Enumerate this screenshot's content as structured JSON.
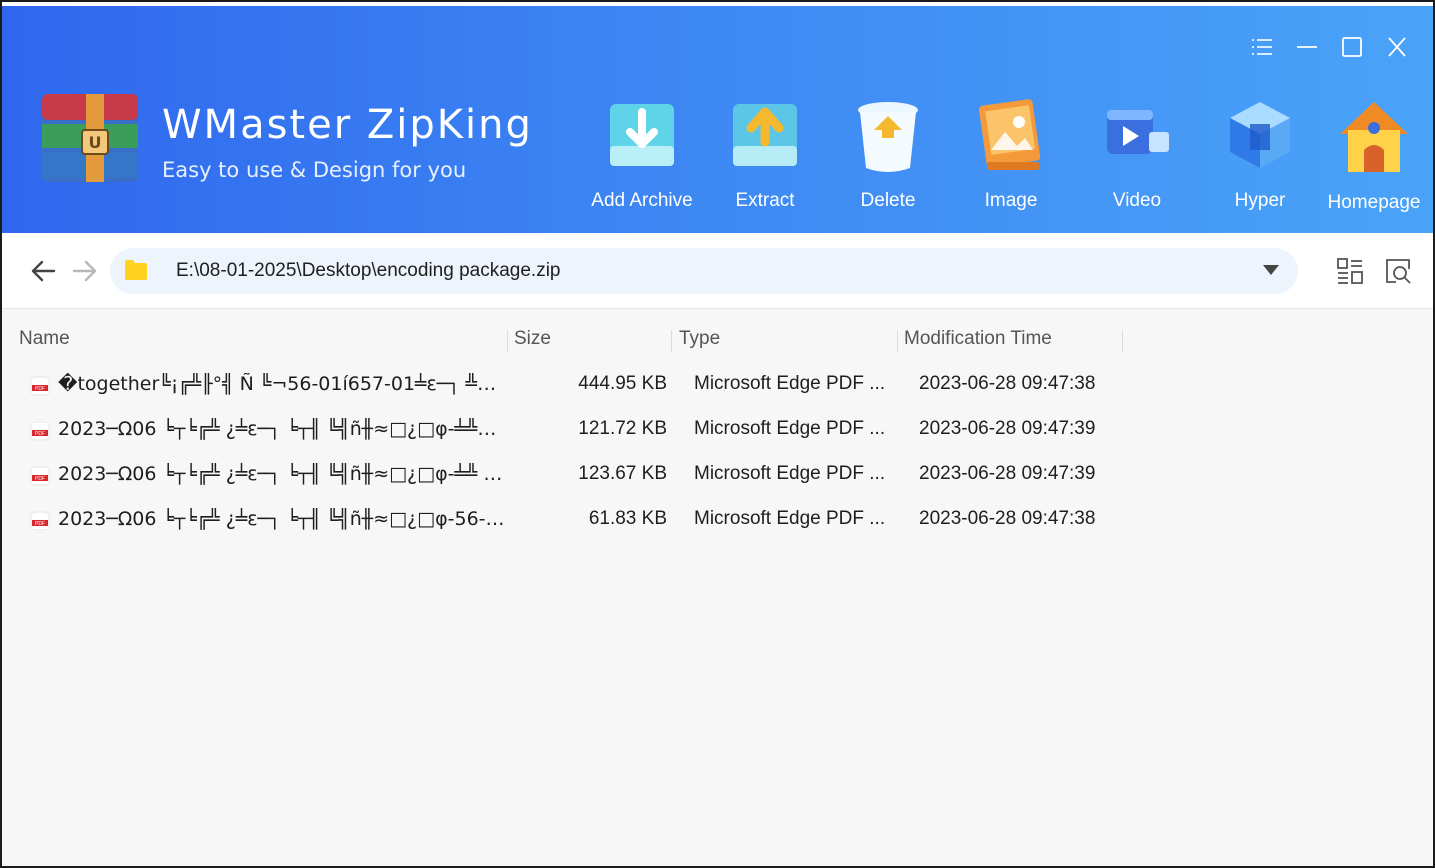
{
  "app": {
    "title": "WMaster ZipKing",
    "subtitle": "Easy to use & Design for you"
  },
  "toolbar": [
    {
      "label": "Add Archive",
      "icon": "add-archive-icon"
    },
    {
      "label": "Extract",
      "icon": "extract-icon"
    },
    {
      "label": "Delete",
      "icon": "delete-icon"
    },
    {
      "label": "Image",
      "icon": "image-icon"
    },
    {
      "label": "Video",
      "icon": "video-icon"
    },
    {
      "label": "Hyper",
      "icon": "hyper-icon"
    },
    {
      "label": "Homepage",
      "icon": "homepage-icon"
    }
  ],
  "window_controls": [
    "menu-icon",
    "minimize-icon",
    "maximize-icon",
    "close-icon"
  ],
  "navigation": {
    "path": "E:\\08-01-2025\\Desktop\\encoding package.zip"
  },
  "columns": {
    "name": "Name",
    "size": "Size",
    "type": "Type",
    "modified": "Modification Time"
  },
  "files": [
    {
      "name": "�together╚¡╔╩╟°╣ Ñ ╚¬56-01í657-01╧ε─┐ ╩╣╪≤╩°╢ ╚╩╟...",
      "size": "444.95 KB",
      "type": "Microsoft Edge PDF ...",
      "modified": "2023-06-28 09:47:38"
    },
    {
      "name": "2023─Ω06 ╘┬╘╔╩ ¿╧ε─┐ ╘┬╢ ╚╣ñ╫≈□¿□φ-╧╩╕ ·┴...",
      "size": "121.72 KB",
      "type": "Microsoft Edge PDF ...",
      "modified": "2023-06-28 09:47:39"
    },
    {
      "name": "2023─Ω06 ╘┬╘╔╩ ¿╧ε─┐ ╘┬╢ ╚╣ñ╫≈□¿□φ-╧╩ ╟□...",
      "size": "123.67 KB",
      "type": "Microsoft Edge PDF ...",
      "modified": "2023-06-28 09:47:39"
    },
    {
      "name": "2023─Ω06 ╘┬╘╔╩ ¿╧ε─┐ ╘┬╢ ╚╣ñ╫≈□¿□φ-56-57...",
      "size": "61.83 KB",
      "type": "Microsoft Edge PDF ...",
      "modified": "2023-06-28 09:47:38"
    }
  ],
  "colors": {
    "header_start": "#2f67ee",
    "header_end": "#4aa3f8",
    "path_bg": "#eef4fc",
    "pdf_red": "#d9262c"
  }
}
